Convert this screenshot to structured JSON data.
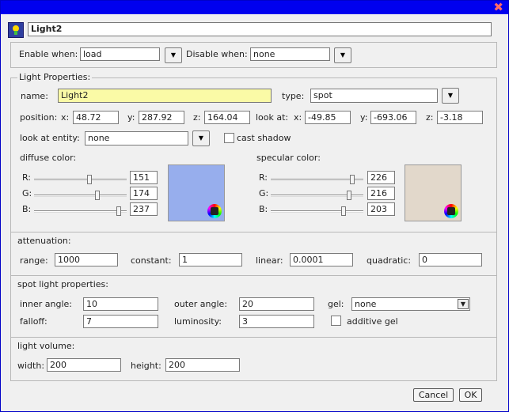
{
  "window": {
    "name": "Light2"
  },
  "activation": {
    "enable_label": "Enable when:",
    "enable_value": "load",
    "disable_label": "Disable when:",
    "disable_value": "none"
  },
  "light_props": {
    "legend": "Light Properties:",
    "name_label": "name:",
    "name_value": "Light2",
    "type_label": "type:",
    "type_value": "spot",
    "position_label": "position:",
    "pos_x_label": "x:",
    "pos_x": "48.72",
    "pos_y_label": "y:",
    "pos_y": "287.92",
    "pos_z_label": "z:",
    "pos_z": "164.04",
    "lookat_label": "look at:",
    "look_x_label": "x:",
    "look_x": "-49.85",
    "look_y_label": "y:",
    "look_y": "-693.06",
    "look_z_label": "z:",
    "look_z": "-3.18",
    "entity_label": "look at entity:",
    "entity_value": "none",
    "cast_shadow_label": "cast shadow",
    "cast_shadow": false,
    "diffuse": {
      "label": "diffuse color:",
      "r_label": "R:",
      "g_label": "G:",
      "b_label": "B:",
      "r": "151",
      "g": "174",
      "b": "237",
      "color": "#97aeed"
    },
    "specular": {
      "label": "specular color:",
      "r_label": "R:",
      "g_label": "G:",
      "b_label": "B:",
      "r": "226",
      "g": "216",
      "b": "203",
      "color": "#e2d8cb"
    }
  },
  "attenuation": {
    "title": "attenuation:",
    "range_label": "range:",
    "range": "1000",
    "constant_label": "constant:",
    "constant": "1",
    "linear_label": "linear:",
    "linear": "0.0001",
    "quadratic_label": "quadratic:",
    "quadratic": "0"
  },
  "spot": {
    "title": "spot light properties:",
    "inner_label": "inner angle:",
    "inner": "10",
    "outer_label": "outer angle:",
    "outer": "20",
    "gel_label": "gel:",
    "gel": "none",
    "falloff_label": "falloff:",
    "falloff": "7",
    "luminosity_label": "luminosity:",
    "luminosity": "3",
    "additive_label": "additive gel",
    "additive": false
  },
  "volume": {
    "title": "light volume:",
    "width_label": "width:",
    "width": "200",
    "height_label": "height:",
    "height": "200"
  },
  "footer": {
    "cancel": "Cancel",
    "ok": "OK"
  },
  "icons": {
    "close": "close-icon",
    "light": "light-bulb-icon",
    "dropdown": "chevron-down-icon",
    "color_picker": "color-wheel-icon"
  }
}
